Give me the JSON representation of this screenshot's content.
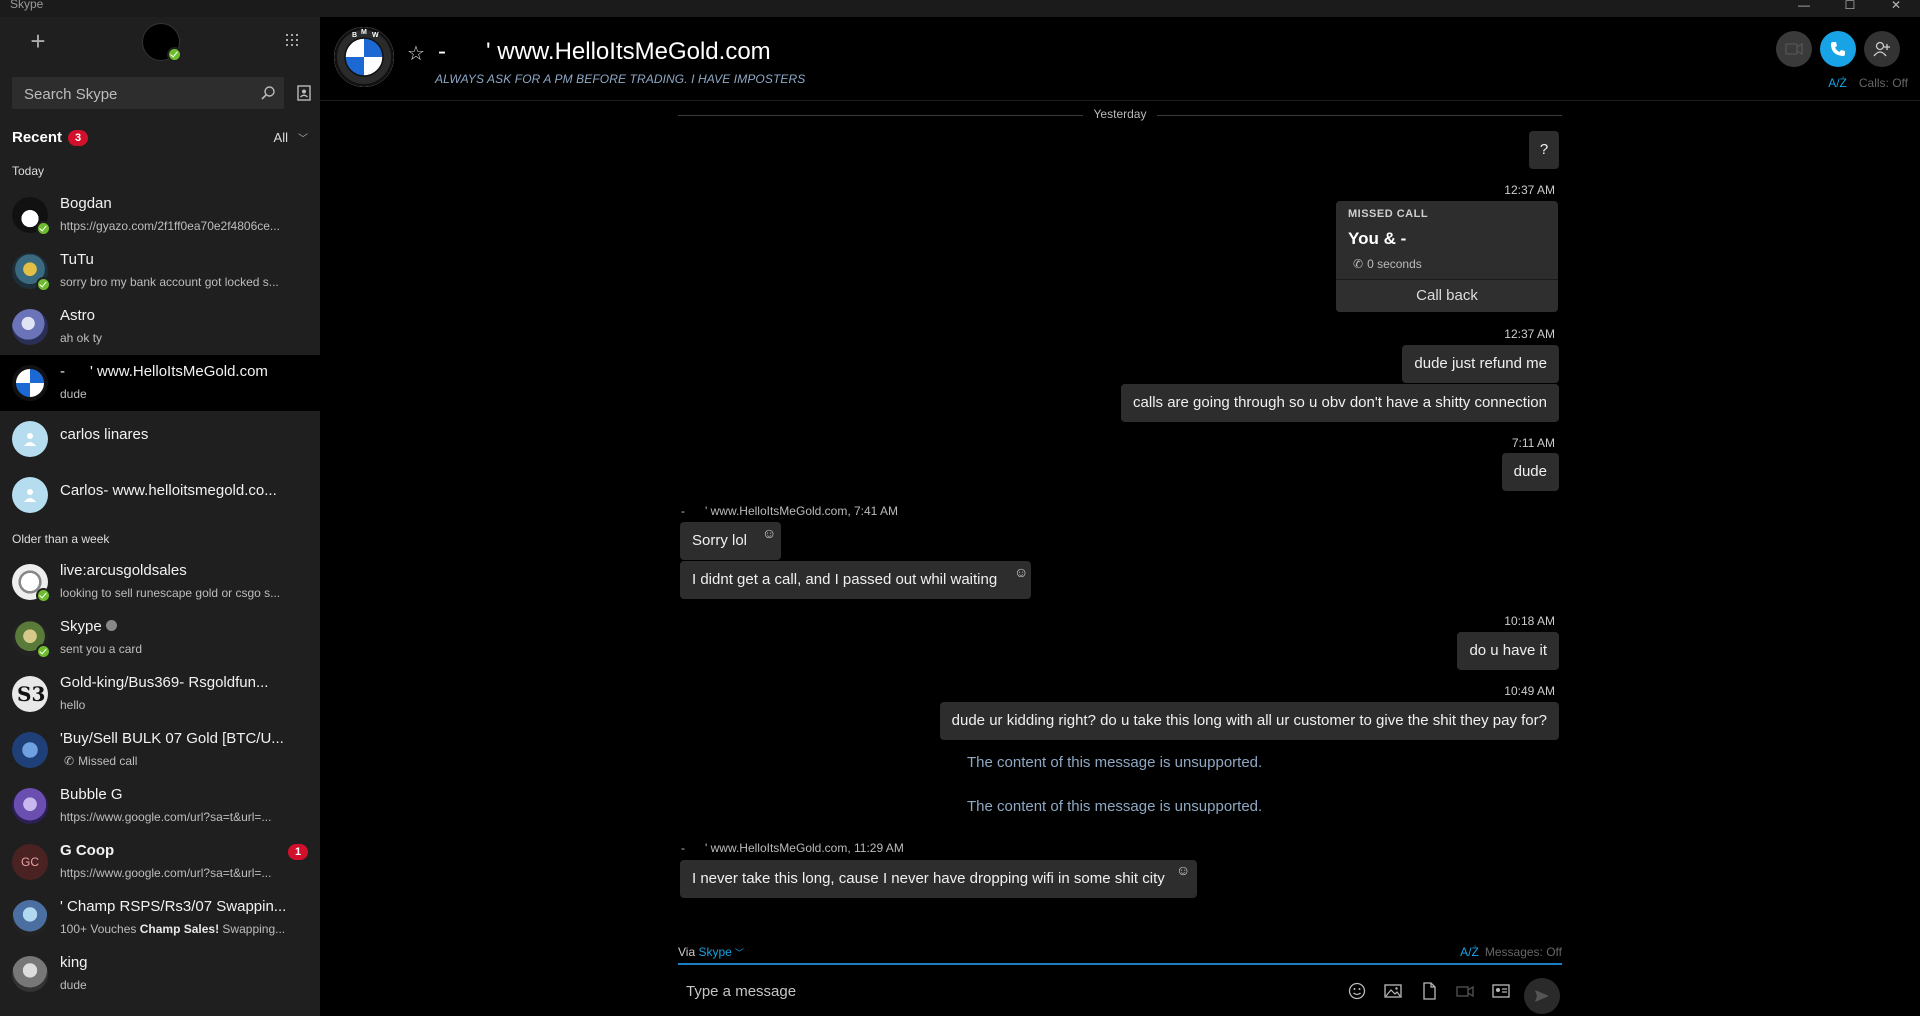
{
  "window": {
    "title": "Skype"
  },
  "sidebar": {
    "search_placeholder": "Search Skype",
    "recent_label": "Recent",
    "recent_badge": "3",
    "filter_label": "All",
    "section_today": "Today",
    "section_older": "Older than a week",
    "conversations": [
      {
        "name": "Bogdan",
        "preview": "https://gyazo.com/2f1ff0ea70e2f4806ce...",
        "online": true
      },
      {
        "name": "TuTu",
        "preview": "sorry bro my bank account got locked s...",
        "online": true
      },
      {
        "name": "Astro",
        "preview": "ah ok ty",
        "online": false
      },
      {
        "name": "-      ' www.HelloItsMeGold.com",
        "preview": "dude",
        "selected": true
      },
      {
        "name": "carlos linares",
        "preview": ""
      },
      {
        "name": "Carlos- www.helloitsmegold.co...",
        "preview": ""
      },
      {
        "name": "live:arcusgoldsales",
        "preview": "looking to sell runescape gold or csgo s...",
        "online": true
      },
      {
        "name": "Skype",
        "preview": "sent you a card",
        "online": true,
        "verified": true
      },
      {
        "name": "Gold-king/Bus369- Rsgoldfun...",
        "preview": "hello"
      },
      {
        "name": "'Buy/Sell BULK 07 Gold [BTC/U...",
        "preview": "Missed call"
      },
      {
        "name": "Bubble G",
        "preview": "https://www.google.com/url?sa=t&url=..."
      },
      {
        "name": "G Coop",
        "preview": "https://www.google.com/url?sa=t&url=...",
        "unread": "1",
        "initials": "GC"
      },
      {
        "name": "' Champ RSPS/Rs3/07 Swappin...",
        "preview_start": "100+ Vouches ",
        "preview_bold": "Champ Sales!",
        "preview_end": " Swapping..."
      },
      {
        "name": "king",
        "preview": "dude"
      }
    ]
  },
  "header": {
    "title": "-      ' www.HelloItsMeGold.com",
    "mood": "ALWAYS ASK FOR A PM BEFORE TRADING. I HAVE IMPOSTERS",
    "calls_status": "Calls: Off",
    "accent": "#17a3e5"
  },
  "chat": {
    "day_separator": "Yesterday",
    "messages": {
      "m1": "?",
      "ts1": "12:37 AM",
      "missed_call": {
        "label": "MISSED CALL",
        "title": "You & -",
        "duration": "0 seconds",
        "action": "Call back"
      },
      "ts2": "12:37 AM",
      "m2": "dude just refund me",
      "m3": "calls are going through so u obv don't have a shitty connection",
      "ts3": "7:11 AM",
      "m4": "dude",
      "sender1": "-      ' www.HelloItsMeGold.com, 7:41 AM",
      "m5": "Sorry lol",
      "m6": "I didnt get a call, and I passed out whil waiting",
      "ts4": "10:18 AM",
      "m7": "do u have it",
      "ts5": "10:49 AM",
      "m8": "dude ur kidding right? do u take this long with all ur customer to give the shit they pay for?",
      "unsupported1": "The content of this message is unsupported.",
      "unsupported2": "The content of this message is unsupported.",
      "sender2": "-      ' www.HelloItsMeGold.com, 11:29 AM",
      "m9": "I never take this long, cause I never have dropping wifi in some shit city"
    }
  },
  "composer": {
    "via_label": "Via",
    "via_brand": "Skype",
    "messages_status": "Messages: Off",
    "placeholder": "Type a message"
  }
}
